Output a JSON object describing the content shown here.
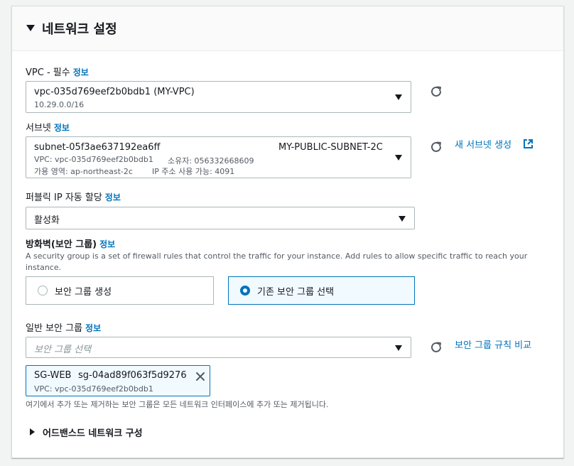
{
  "section": {
    "title": "네트워크 설정",
    "info_label": "정보"
  },
  "vpc": {
    "label": "VPC - 필수",
    "value": "vpc-035d769eef2b0bdb1 (MY-VPC)",
    "cidr": "10.29.0.0/16"
  },
  "subnet": {
    "label": "서브넷",
    "id": "subnet-05f3ae637192ea6ff",
    "name": "MY-PUBLIC-SUBNET-2C",
    "vpc_line": "VPC: vpc-035d769eef2b0bdb1",
    "owner_line": "소유자: 056332668609",
    "az_line": "가용 영역: ap-northeast-2c",
    "ip_line": "IP 주소 사용 가능: 4091",
    "create_link": "새 서브넷 생성"
  },
  "public_ip": {
    "label": "퍼블릭 IP 자동 할당",
    "value": "활성화"
  },
  "firewall": {
    "label": "방화벽(보안 그룹)",
    "description": "A security group is a set of firewall rules that control the traffic for your instance. Add rules to allow specific traffic to reach your instance.",
    "option_create": "보안 그룹 생성",
    "option_existing": "기존 보안 그룹 선택",
    "selected": "existing"
  },
  "common_sg": {
    "label": "일반 보안 그룹",
    "placeholder": "보안 그룹 선택",
    "compare_link": "보안 그룹 규칙 비교",
    "token_name": "SG-WEB",
    "token_id": "sg-04ad89f063f5d9276",
    "token_vpc": "VPC: vpc-035d769eef2b0bdb1",
    "hint": "여기에서 추가 또는 제거하는 보안 그룹은 모든 네트워크 인터페이스에 추가 또는 제거됩니다."
  },
  "advanced": {
    "label": "어드밴스드 네트워크 구성"
  },
  "colors": {
    "link": "#0073bb",
    "border": "#aab7b8",
    "selected_bg": "#f1faff"
  }
}
